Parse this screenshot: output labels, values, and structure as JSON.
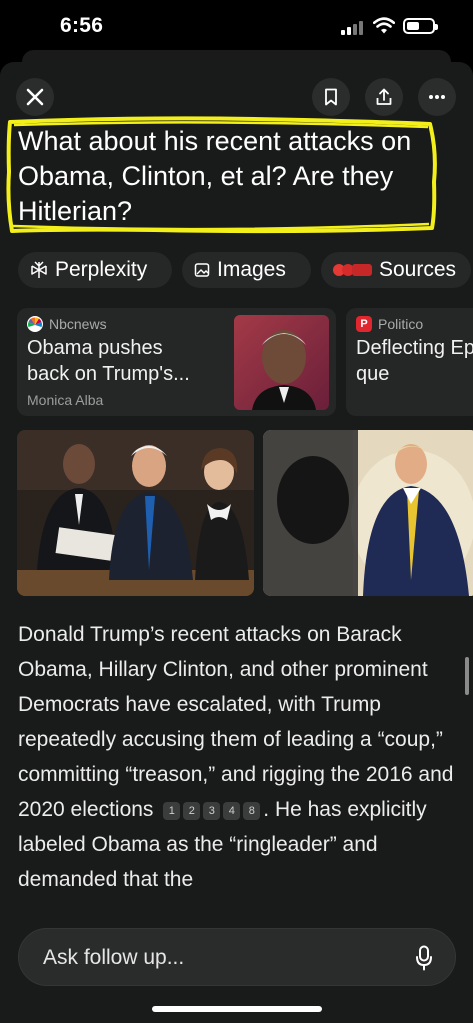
{
  "status_bar": {
    "time": "6:56"
  },
  "header": {
    "close_icon": "close-icon",
    "bookmark_icon": "bookmark-icon",
    "share_icon": "share-icon",
    "more_icon": "more-icon"
  },
  "question": "What about his recent attacks on Obama, Clinton, et al? Are they Hitlerian?",
  "tabs": [
    {
      "label": "Perplexity",
      "icon": "perplexity-icon"
    },
    {
      "label": "Images",
      "icon": "image-icon"
    },
    {
      "label": "Sources",
      "icon": "sources-favicons"
    }
  ],
  "sources": [
    {
      "publisher": "Nbcnews",
      "title": "Obama pushes back on Trump's...",
      "author": "Monica Alba"
    },
    {
      "publisher": "Politico",
      "title": "Deflecting Epstein que"
    }
  ],
  "answer": {
    "text_1": "Donald Trump’s recent attacks on Barack Obama, Hillary Clinton, and other prominent Democrats have escalated, with Trump repeatedly accusing them of leading a “coup,” committing “treason,” and rigging the 2016 and 2020 elections",
    "citations": [
      "1",
      "2",
      "3",
      "4",
      "8"
    ],
    "text_2": ". He has explicitly labeled Obama as the “ringleader” and demanded that the"
  },
  "follow_up": {
    "placeholder": "Ask follow up..."
  },
  "colors": {
    "background": "#191a1a",
    "highlight": "#f2ef1a",
    "chip": "#262727"
  }
}
